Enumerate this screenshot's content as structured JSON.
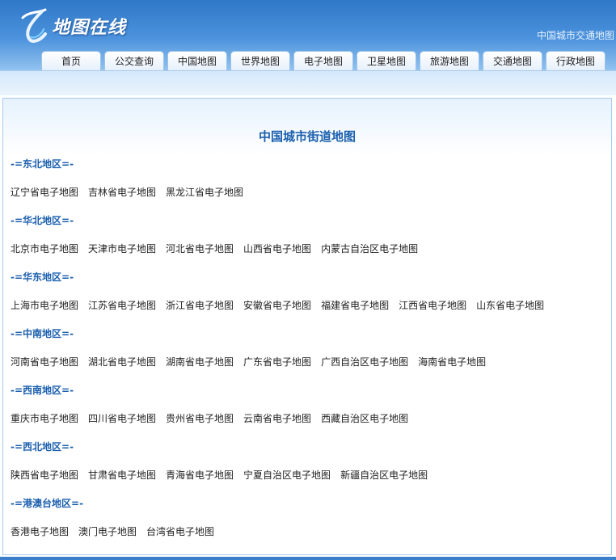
{
  "header": {
    "logo_text": "地图在线",
    "top_link": "中国城市交通地图"
  },
  "nav": {
    "tabs": [
      "首页",
      "公交查询",
      "中国地图",
      "世界地图",
      "电子地图",
      "卫星地图",
      "旅游地图",
      "交通地图",
      "行政地图"
    ]
  },
  "main": {
    "title": "中国城市街道地图",
    "regions": [
      {
        "title": "-=东北地区=-",
        "links": [
          "辽宁省电子地图",
          "吉林省电子地图",
          "黑龙江省电子地图"
        ]
      },
      {
        "title": "-=华北地区=-",
        "links": [
          "北京市电子地图",
          "天津市电子地图",
          "河北省电子地图",
          "山西省电子地图",
          "内蒙古自治区电子地图"
        ]
      },
      {
        "title": "-=华东地区=-",
        "links": [
          "上海市电子地图",
          "江苏省电子地图",
          "浙江省电子地图",
          "安徽省电子地图",
          "福建省电子地图",
          "江西省电子地图",
          "山东省电子地图"
        ]
      },
      {
        "title": "-=中南地区=-",
        "links": [
          "河南省电子地图",
          "湖北省电子地图",
          "湖南省电子地图",
          "广东省电子地图",
          "广西自治区电子地图",
          "海南省电子地图"
        ]
      },
      {
        "title": "-=西南地区=-",
        "links": [
          "重庆市电子地图",
          "四川省电子地图",
          "贵州省电子地图",
          "云南省电子地图",
          "西藏自治区电子地图"
        ]
      },
      {
        "title": "-=西北地区=-",
        "links": [
          "陕西省电子地图",
          "甘肃省电子地图",
          "青海省电子地图",
          "宁夏自治区电子地图",
          "新疆自治区电子地图"
        ]
      },
      {
        "title": "-=港澳台地区=-",
        "links": [
          "香港电子地图",
          "澳门电子地图",
          "台湾省电子地图"
        ]
      }
    ]
  }
}
